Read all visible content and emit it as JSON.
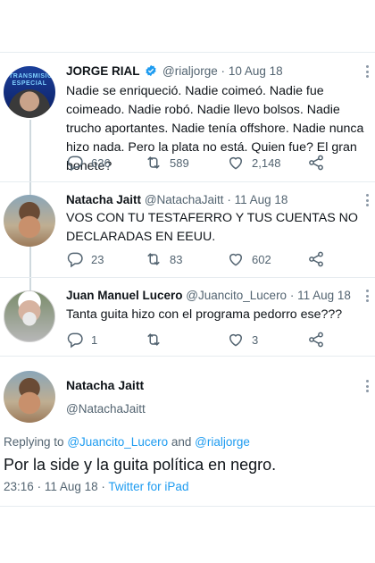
{
  "tweets": [
    {
      "name": "JORGE RIAL",
      "handle": "@rialjorge",
      "date": "10 Aug 18",
      "avatar_label": "TRANSMISIÓN ESPECIAL",
      "text": "Nadie se enriqueció. Nadie coimeó. Nadie fue coimeado. Nadie robó. Nadie llevo bolsos. Nadie trucho aportantes. Nadie tenía offshore. Nadie nunca hizo nada. Pero la plata no está. Quien fue? El gran bonete?",
      "replies": "636",
      "retweets": "589",
      "likes": "2,148"
    },
    {
      "name": "Natacha Jaitt",
      "handle": "@NatachaJaitt",
      "date": "11 Aug 18",
      "text": "VOS CON TU TESTAFERRO Y TUS CUENTAS NO DECLARADAS EN EEUU.",
      "replies": "23",
      "retweets": "83",
      "likes": "602"
    },
    {
      "name": "Juan Manuel Lucero",
      "handle": "@Juancito_Lucero",
      "date": "11 Aug 18",
      "text": "Tanta guita hizo con el programa pedorro ese???",
      "replies": "1",
      "retweets": "",
      "likes": "3"
    }
  ],
  "main_tweet": {
    "name": "Natacha Jaitt",
    "handle": "@NatachaJaitt",
    "replying_prefix": "Replying to",
    "replying_user1": "@Juancito_Lucero",
    "replying_and": "and",
    "replying_user2": "@rialjorge",
    "text": "Por la side y la guita política en negro.",
    "time": "23:16",
    "date": "11 Aug 18",
    "source": "Twitter for iPad"
  },
  "colors": {
    "accent": "#1d9bf0",
    "muted": "#536471",
    "text": "#0f1419",
    "divider": "#e6ecf0"
  },
  "icons": [
    "verified-badge-icon",
    "reply-icon",
    "retweet-icon",
    "like-icon",
    "share-icon",
    "more-icon"
  ]
}
